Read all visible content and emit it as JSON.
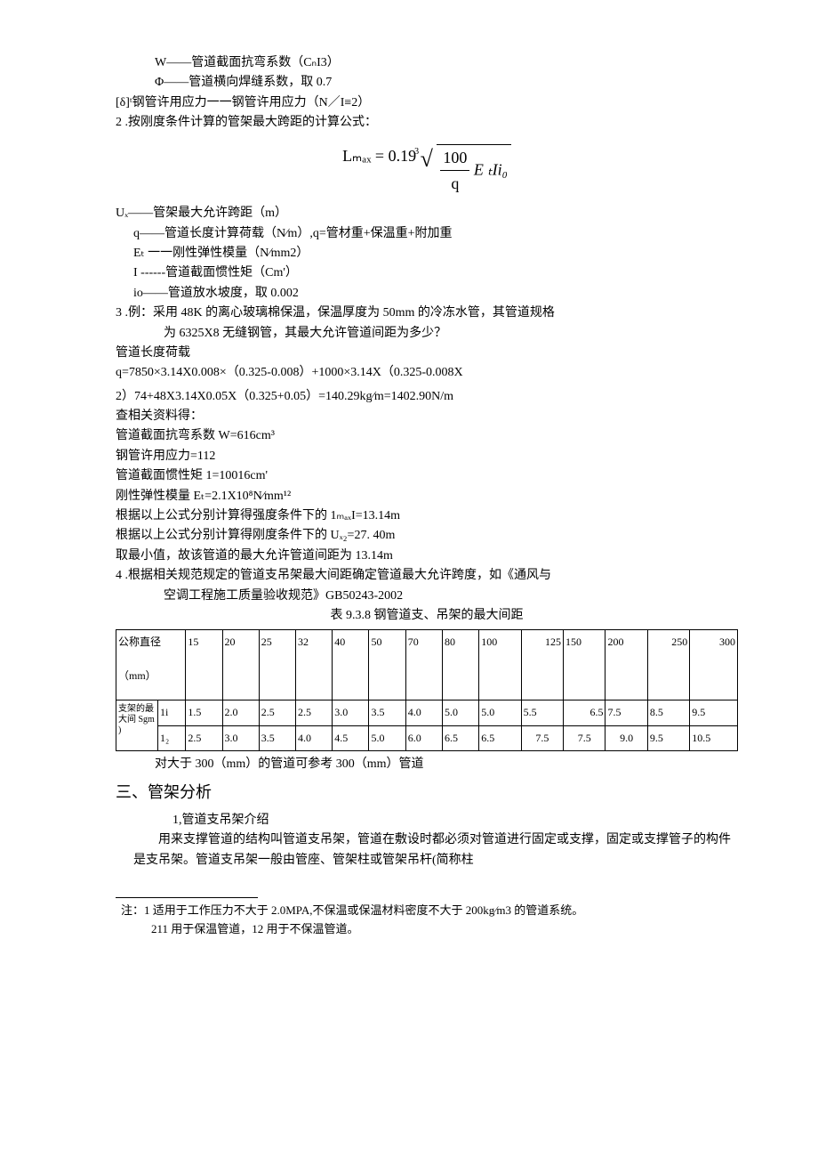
{
  "defs": {
    "W": "W——管道截面抗弯系数（CₙI3）",
    "Phi": "Φ——管道横向焊缝系数，取 0.7",
    "delta": "[δ]ᵗ钢管许用应力一一钢管许用应力（N／Ι≡2）",
    "item2": "2 .按刚度条件计算的管架最大跨距的计算公式：",
    "Ux": "Uₓ——管架最大允许跨距（m）",
    "q": "q——管道长度计算荷载（N∕m）,q=管材重+保温重+附加重",
    "Et": "Eₜ 一一刚性弹性模量（N∕mm2）",
    "I": "I ------管道截面惯性矩（Cm'）",
    "io": "io——管道放水坡度，取 0.002",
    "item3a": "3 .例：采用 48K 的离心玻璃棉保温，保温厚度为 50mm 的冷冻水管，其管道规格",
    "item3b": "为 6325X8 无缝钢管，其最大允许管道间距为多少？",
    "loadLabel": "管道长度荷载",
    "eq1": "q=7850×3.14X0.008×（0.325-0.008）+1000×3.14X（0.325-0.008X",
    "eq2": "2）74+48X3.14X0.05X（0.325+0.05）=140.29kg∕m=1402.90N/m",
    "lookup": "查相关资料得：",
    "Wval": "管道截面抗弯系数 W=616cm³",
    "sigma": "钢管许用应力=112",
    "Ival": "管道截面惯性矩 1=10016cm'",
    "Eval": "刚性弹性模量 Eₜ=2.1X10⁸N∕mm¹²",
    "res1": "根据以上公式分别计算得强度条件下的 1ₘₐₓI=13.14m",
    "res2": "根据以上公式分别计算得刚度条件下的 Uₓ₂=27. 40m",
    "min": "取最小值，故该管道的最大允许管道间距为 13.14m",
    "item4a": "4 .根据相关规范规定的管道支吊架最大间距确定管道最大允许跨度，如《通风与",
    "item4b": "空调工程施工质量验收规范》GB50243-2002",
    "tableTitle": "表 9.3.8 钢管道支、吊架的最大间距",
    "tableNote": "对大于 300（mm）的管道可参考 300（mm）管道",
    "section3": "三、管架分析",
    "intro1": "1,管道支吊架介绍",
    "para1": "用来支撑管道的结构叫管道支吊架，管道在敷设时都必须对管道进行固定或支撑，固定或支撑管子的构件是支吊架。管道支吊架一般由管座、管架柱或管架吊杆(简称柱",
    "fn1": "注：1 适用于工作压力不大于 2.0MPA,不保温或保温材料密度不大于 200kg∕m3 的管道系统。",
    "fn2": "211 用于保温管道，12 用于不保温管道。"
  },
  "formula": {
    "left": "Lₘₐₓ = 0.19",
    "root_index": "3",
    "num": "100",
    "den": "q",
    "tail": " E ₜIi₀"
  },
  "table": {
    "header": [
      "公称直径",
      "15",
      "20",
      "25",
      "32",
      "40",
      "50",
      "70",
      "80",
      "100",
      "125",
      "150",
      "200",
      "250",
      "300"
    ],
    "headerUnit": "（mm）",
    "rowGroupLabel": "支架的最大间 Sgm )",
    "row1label": "1i",
    "row1": [
      "1.5",
      "2.0",
      "2.5",
      "2.5",
      "3.0",
      "3.5",
      "4.0",
      "5.0",
      "5.0",
      "5.5",
      "6.5",
      "7.5",
      "8.5",
      "9.5"
    ],
    "row2label": "1₂",
    "row2": [
      "2.5",
      "3.0",
      "3.5",
      "4.0",
      "4.5",
      "5.0",
      "6.0",
      "6.5",
      "6.5",
      "7.5",
      "7.5",
      "9.0",
      "9.5",
      "10.5"
    ]
  }
}
